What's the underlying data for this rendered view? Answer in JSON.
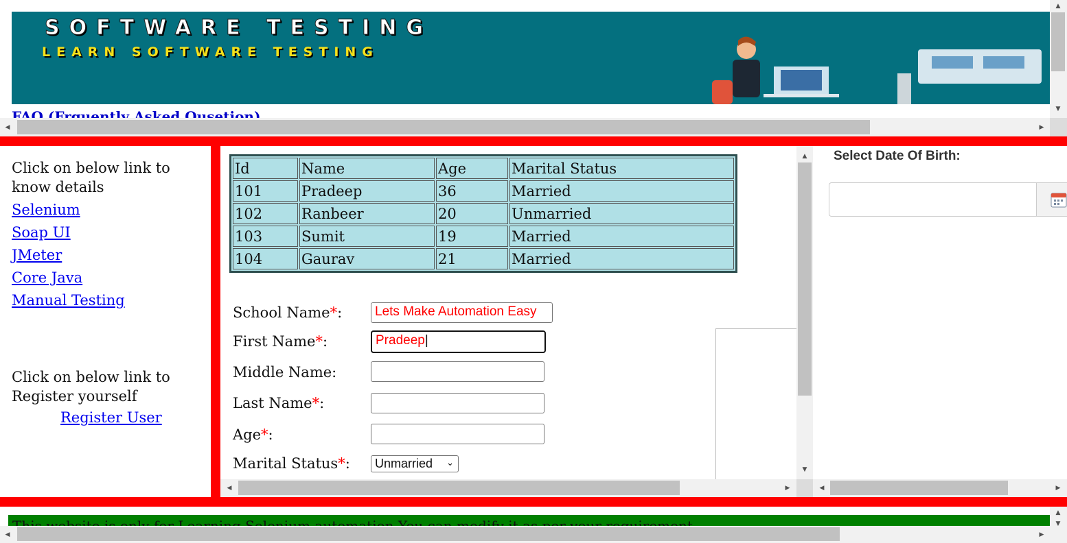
{
  "banner": {
    "title": "SOFTWARE TESTING",
    "subtitle": "LEARN SOFTWARE TESTING"
  },
  "faq_link": "FAQ (Frquently Asked Qusetion)",
  "left": {
    "intro": "Click on below link to know details",
    "links": [
      "Selenium",
      "Soap UI",
      "JMeter",
      "Core Java",
      "Manual Testing"
    ],
    "register_intro": "Click on below link to Register yourself",
    "register_link": "Register User"
  },
  "table": {
    "headers": [
      "Id",
      "Name",
      "Age",
      "Marital Status"
    ],
    "rows": [
      [
        "101",
        "Pradeep",
        "36",
        "Married"
      ],
      [
        "102",
        "Ranbeer",
        "20",
        "Unmarried"
      ],
      [
        "103",
        "Sumit",
        "19",
        "Married"
      ],
      [
        "104",
        "Gaurav",
        "21",
        "Married"
      ]
    ]
  },
  "form": {
    "school_label": "School Name",
    "school_value": "Lets Make Automation Easy",
    "first_label": "First Name",
    "first_value": "Pradeep",
    "middle_label": "Middle Name:",
    "last_label": "Last Name",
    "age_label": "Age",
    "marital_label": "Marital Status",
    "marital_value": "Unmarried",
    "required_mark": "*",
    "colon": ":"
  },
  "right": {
    "dob_label": "Select Date Of Birth:"
  },
  "footer": {
    "text": "This website is only for Learning Selenium automation You can modify it as per your requirement"
  },
  "colors": {
    "divider": "#ff0000",
    "banner_bg": "#04707f",
    "table_bg": "#b0e0e6",
    "footer_bg": "#008000"
  }
}
